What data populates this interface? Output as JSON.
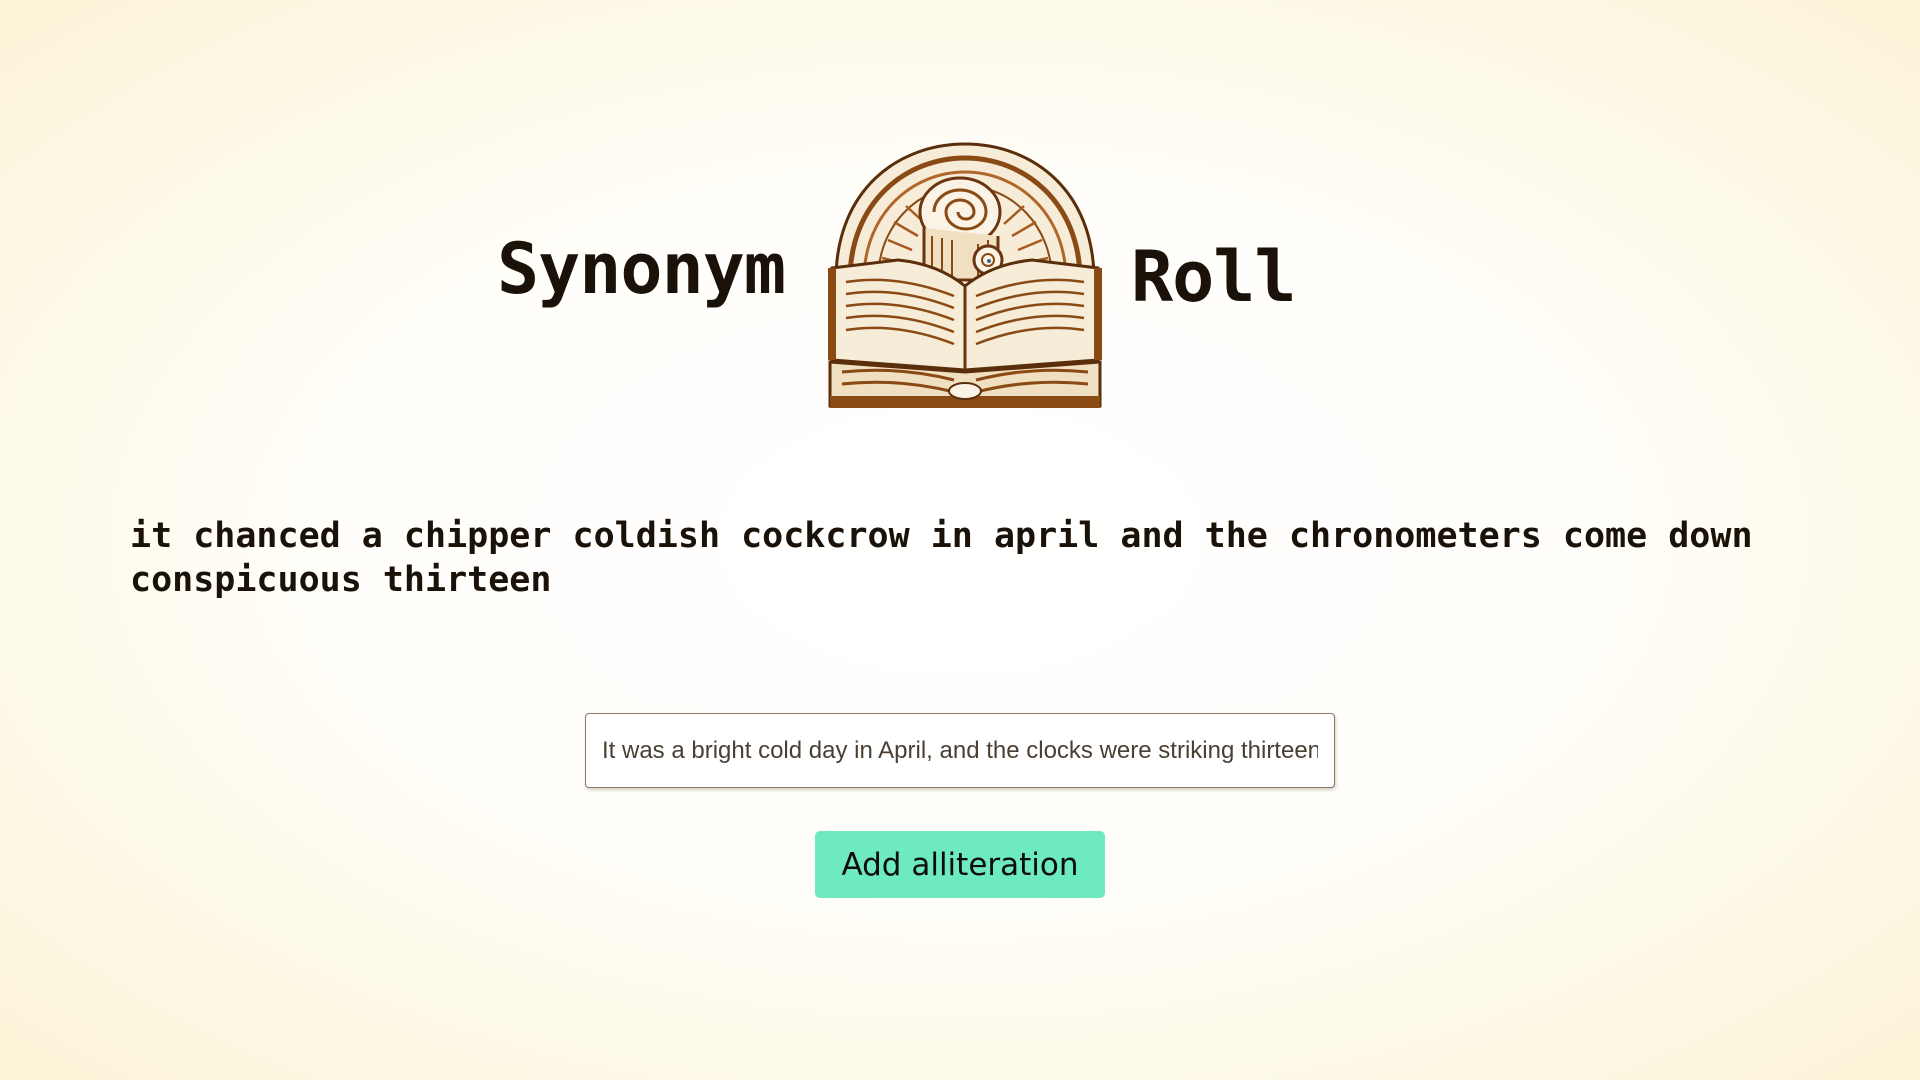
{
  "header": {
    "title_left": "Synonym",
    "title_right": "Roll",
    "logo_icon": "book-swirl-logo-icon"
  },
  "output": {
    "text": "it chanced a chipper coldish cockcrow in april and the chronometers come down conspicuous thirteen"
  },
  "input": {
    "value": "It was a bright cold day in April, and the clocks were striking thirteen."
  },
  "action": {
    "button_label": "Add alliteration"
  },
  "colors": {
    "background": "#fdf8e3",
    "button": "#6eeac0",
    "logo_brown": "#8a4a14",
    "text": "#1a1208"
  }
}
